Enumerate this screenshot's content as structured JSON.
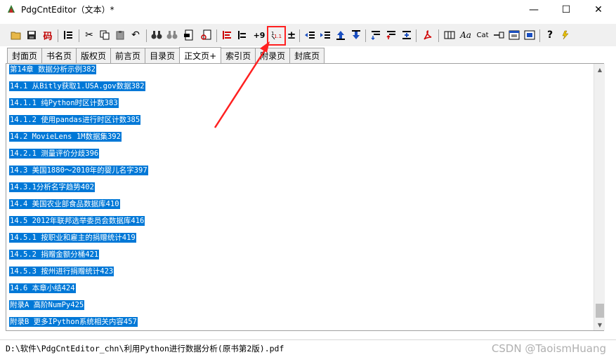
{
  "window": {
    "title": "PdgCntEditor（文本）*",
    "minimize_glyph": "—",
    "maximize_glyph": "☐",
    "close_glyph": "✕"
  },
  "toolbar": {
    "redo_label": "码",
    "number_label": "+9",
    "plusminus_label": "±",
    "question_label": "?",
    "case_label": "Aa",
    "cat_label": "Cat",
    "icons": [
      "open-folder-icon",
      "save-icon",
      "encoding-icon",
      "list-icon",
      "cut-icon",
      "copy-icon",
      "paste-icon",
      "undo-icon",
      "find-icon",
      "find-replace-icon",
      "bookmark-page-icon",
      "page-search-icon",
      "align-left-icon",
      "align-indent-icon",
      "number-icon",
      "toc-number-icon",
      "plus-minus-icon",
      "outdent-icon",
      "indent-icon",
      "move-up-icon",
      "move-down-icon",
      "level-icon",
      "sort-icon",
      "expand-icon",
      "pdf-icon",
      "columns-icon",
      "case-icon",
      "category-icon",
      "link-icon",
      "window-icon",
      "image-icon",
      "help-icon",
      "run-icon"
    ]
  },
  "tabs": [
    {
      "label": "封面页"
    },
    {
      "label": "书名页"
    },
    {
      "label": "版权页"
    },
    {
      "label": "前言页"
    },
    {
      "label": "目录页"
    },
    {
      "label": "正文页+",
      "active": true
    },
    {
      "label": "索引页"
    },
    {
      "label": "附录页"
    },
    {
      "label": "封底页"
    }
  ],
  "lines": [
    "第14章 数据分析示例382",
    "14.1 从Bitly获取1.USA.gov数据382",
    "14.1.1 纯Python时区计数383",
    "14.1.2 使用pandas进行时区计数385",
    "14.2 MovieLens 1M数据集392",
    "14.2.1 测量评价分歧396",
    "14.3 美国1880～2010年的婴儿名字397",
    "14.3.1分析名字趋势402",
    "14.4 美国农业部食品数据库410",
    "14.5 2012年联邦选举委员会数据库416",
    "14.5.1 按职业和雇主的捐赠统计419",
    "14.5.2 捐赠金额分桶421",
    "14.5.3 按州进行捐赠统计423",
    "14.6 本章小结424",
    "附录A 高阶NumPy425",
    "附录B 更多IPython系统相关内容457"
  ],
  "status": {
    "path": "D:\\软件\\PdgCntEditor_chn\\利用Python进行数据分析(原书第2版).pdf",
    "watermark": "CSDN @TaoismHuang"
  },
  "colors": {
    "selection": "#0078d7",
    "highlight": "#ff2020"
  }
}
